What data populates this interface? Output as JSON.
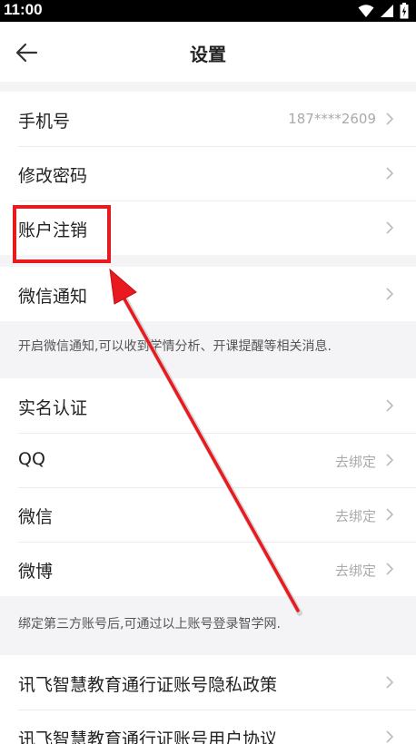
{
  "status_bar": {
    "time": "11:00"
  },
  "header": {
    "title": "设置"
  },
  "groups": {
    "account": [
      {
        "label": "手机号",
        "value": "187****2609"
      },
      {
        "label": "修改密码",
        "value": ""
      },
      {
        "label": "账户注销",
        "value": ""
      }
    ],
    "wechat_notify": {
      "label": "微信通知"
    },
    "wechat_note": "开启微信通知,可以收到学情分析、开课提醒等相关消息.",
    "identity": [
      {
        "label": "实名认证",
        "value": ""
      },
      {
        "label": "QQ",
        "value": "去绑定"
      },
      {
        "label": "微信",
        "value": "去绑定"
      },
      {
        "label": "微博",
        "value": "去绑定"
      }
    ],
    "bind_note": "绑定第三方账号后,可通过以上账号登录智学网.",
    "policies": [
      {
        "label": "讯飞智慧教育通行证账号隐私政策"
      },
      {
        "label": "讯飞智慧教育通行证账号用户协议"
      }
    ]
  },
  "colors": {
    "annotation_red": "#e8191f",
    "background": "#f4f4f6"
  }
}
